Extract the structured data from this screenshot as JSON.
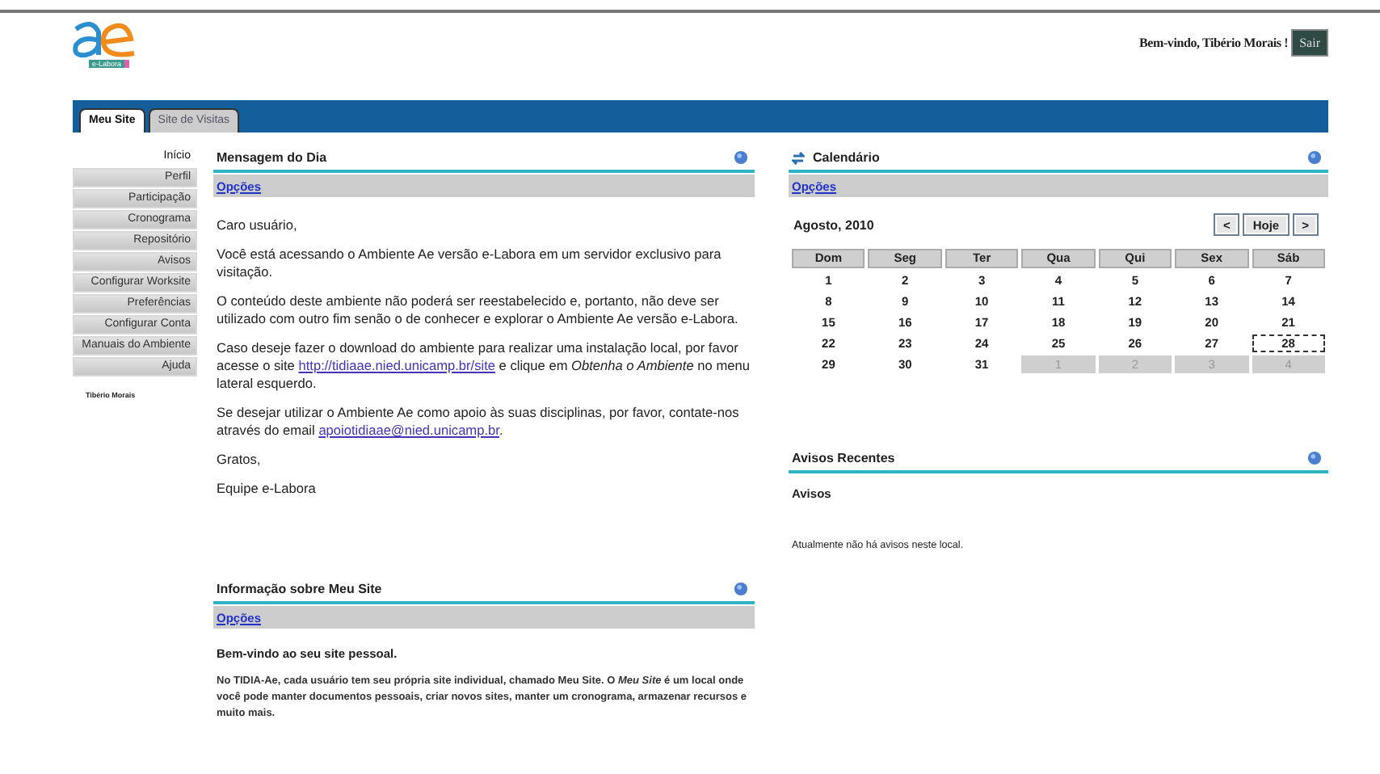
{
  "logo": {
    "text": "e-Labora"
  },
  "header": {
    "welcome": "Bem-vindo, Tibério Morais !",
    "logout": "Sair"
  },
  "tabs": [
    {
      "label": "Meu Site",
      "selected": true
    },
    {
      "label": "Site de Visitas",
      "selected": false
    }
  ],
  "sidebar": {
    "items": [
      {
        "label": "Início",
        "selected": true
      },
      {
        "label": "Perfil",
        "selected": false
      },
      {
        "label": "Participação",
        "selected": false
      },
      {
        "label": "Cronograma",
        "selected": false
      },
      {
        "label": "Repositório",
        "selected": false
      },
      {
        "label": "Avisos",
        "selected": false
      },
      {
        "label": "Configurar Worksite",
        "selected": false
      },
      {
        "label": "Preferências",
        "selected": false
      },
      {
        "label": "Configurar Conta",
        "selected": false
      },
      {
        "label": "Manuais do Ambiente",
        "selected": false
      },
      {
        "label": "Ajuda",
        "selected": false
      }
    ],
    "user": "Tibério Morais"
  },
  "message_of_day": {
    "title": "Mensagem do Dia",
    "options": "Opções",
    "paragraphs": [
      [
        {
          "kind": "text",
          "text": "Caro usuário,"
        }
      ],
      [
        {
          "kind": "text",
          "text": "Você está acessando o Ambiente Ae versão e-Labora em um servidor exclusivo para visitação."
        }
      ],
      [
        {
          "kind": "text",
          "text": "O conteúdo deste ambiente não poderá ser reestabelecido e, portanto, não deve ser utilizado com outro fim senão o de conhecer e explorar o Ambiente Ae versão e-Labora."
        }
      ],
      [
        {
          "kind": "text",
          "text": "Caso deseje fazer o download do ambiente para realizar uma instalação local, por favor acesse o site "
        },
        {
          "kind": "link",
          "text": "http://tidiaae.nied.unicamp.br/site"
        },
        {
          "kind": "text",
          "text": " e clique em *Obtenha o Ambiente* no menu lateral esquerdo."
        }
      ],
      [
        {
          "kind": "text",
          "text": "Se desejar utilizar o Ambiente Ae como apoio às suas disciplinas, por favor, contate-nos através do email "
        },
        {
          "kind": "link",
          "text": "apoiotidiaae@nied.unicamp.br"
        },
        {
          "kind": "text",
          "text": "."
        }
      ],
      [
        {
          "kind": "text",
          "text": "Gratos,"
        }
      ],
      [
        {
          "kind": "text",
          "text": "Equipe e-Labora"
        }
      ]
    ]
  },
  "site_info": {
    "title": "Informação sobre Meu Site",
    "options": "Opções",
    "heading": "Bem-vindo ao seu site pessoal.",
    "text": "No TIDIA-Ae, cada usuário tem seu própria site individual, chamado Meu Site. O *Meu Site* é um local onde você pode manter documentos pessoais, criar novos sites, manter um cronograma, armazenar recursos e muito mais."
  },
  "calendar": {
    "title": "Calendário",
    "options": "Opções",
    "month": "Agosto, 2010",
    "prev": "<",
    "today_button": "Hoje",
    "next": ">",
    "weekdays": [
      "Dom",
      "Seg",
      "Ter",
      "Qua",
      "Qui",
      "Sex",
      "Sáb"
    ],
    "days": [
      {
        "day": "1",
        "kind": "current",
        "today": false
      },
      {
        "day": "2",
        "kind": "current",
        "today": false
      },
      {
        "day": "3",
        "kind": "current",
        "today": false
      },
      {
        "day": "4",
        "kind": "current",
        "today": false
      },
      {
        "day": "5",
        "kind": "current",
        "today": false
      },
      {
        "day": "6",
        "kind": "current",
        "today": false
      },
      {
        "day": "7",
        "kind": "current",
        "today": false
      },
      {
        "day": "8",
        "kind": "current",
        "today": false
      },
      {
        "day": "9",
        "kind": "current",
        "today": false
      },
      {
        "day": "10",
        "kind": "current",
        "today": false
      },
      {
        "day": "11",
        "kind": "current",
        "today": false
      },
      {
        "day": "12",
        "kind": "current",
        "today": false
      },
      {
        "day": "13",
        "kind": "current",
        "today": false
      },
      {
        "day": "14",
        "kind": "current",
        "today": false
      },
      {
        "day": "15",
        "kind": "current",
        "today": false
      },
      {
        "day": "16",
        "kind": "current",
        "today": false
      },
      {
        "day": "17",
        "kind": "current",
        "today": false
      },
      {
        "day": "18",
        "kind": "current",
        "today": false
      },
      {
        "day": "19",
        "kind": "current",
        "today": false
      },
      {
        "day": "20",
        "kind": "current",
        "today": false
      },
      {
        "day": "21",
        "kind": "current",
        "today": false
      },
      {
        "day": "22",
        "kind": "current",
        "today": false
      },
      {
        "day": "23",
        "kind": "current",
        "today": false
      },
      {
        "day": "24",
        "kind": "current",
        "today": false
      },
      {
        "day": "25",
        "kind": "current",
        "today": false
      },
      {
        "day": "26",
        "kind": "current",
        "today": false
      },
      {
        "day": "27",
        "kind": "current",
        "today": false
      },
      {
        "day": "28",
        "kind": "current",
        "today": true
      },
      {
        "day": "29",
        "kind": "current",
        "today": false
      },
      {
        "day": "30",
        "kind": "current",
        "today": false
      },
      {
        "day": "31",
        "kind": "current",
        "today": false
      },
      {
        "day": "1",
        "kind": "other",
        "today": false
      },
      {
        "day": "2",
        "kind": "other",
        "today": false
      },
      {
        "day": "3",
        "kind": "other",
        "today": false
      },
      {
        "day": "4",
        "kind": "other",
        "today": false
      }
    ]
  },
  "announcements": {
    "title": "Avisos Recentes",
    "heading": "Avisos",
    "text": "Atualmente não há avisos neste local."
  }
}
